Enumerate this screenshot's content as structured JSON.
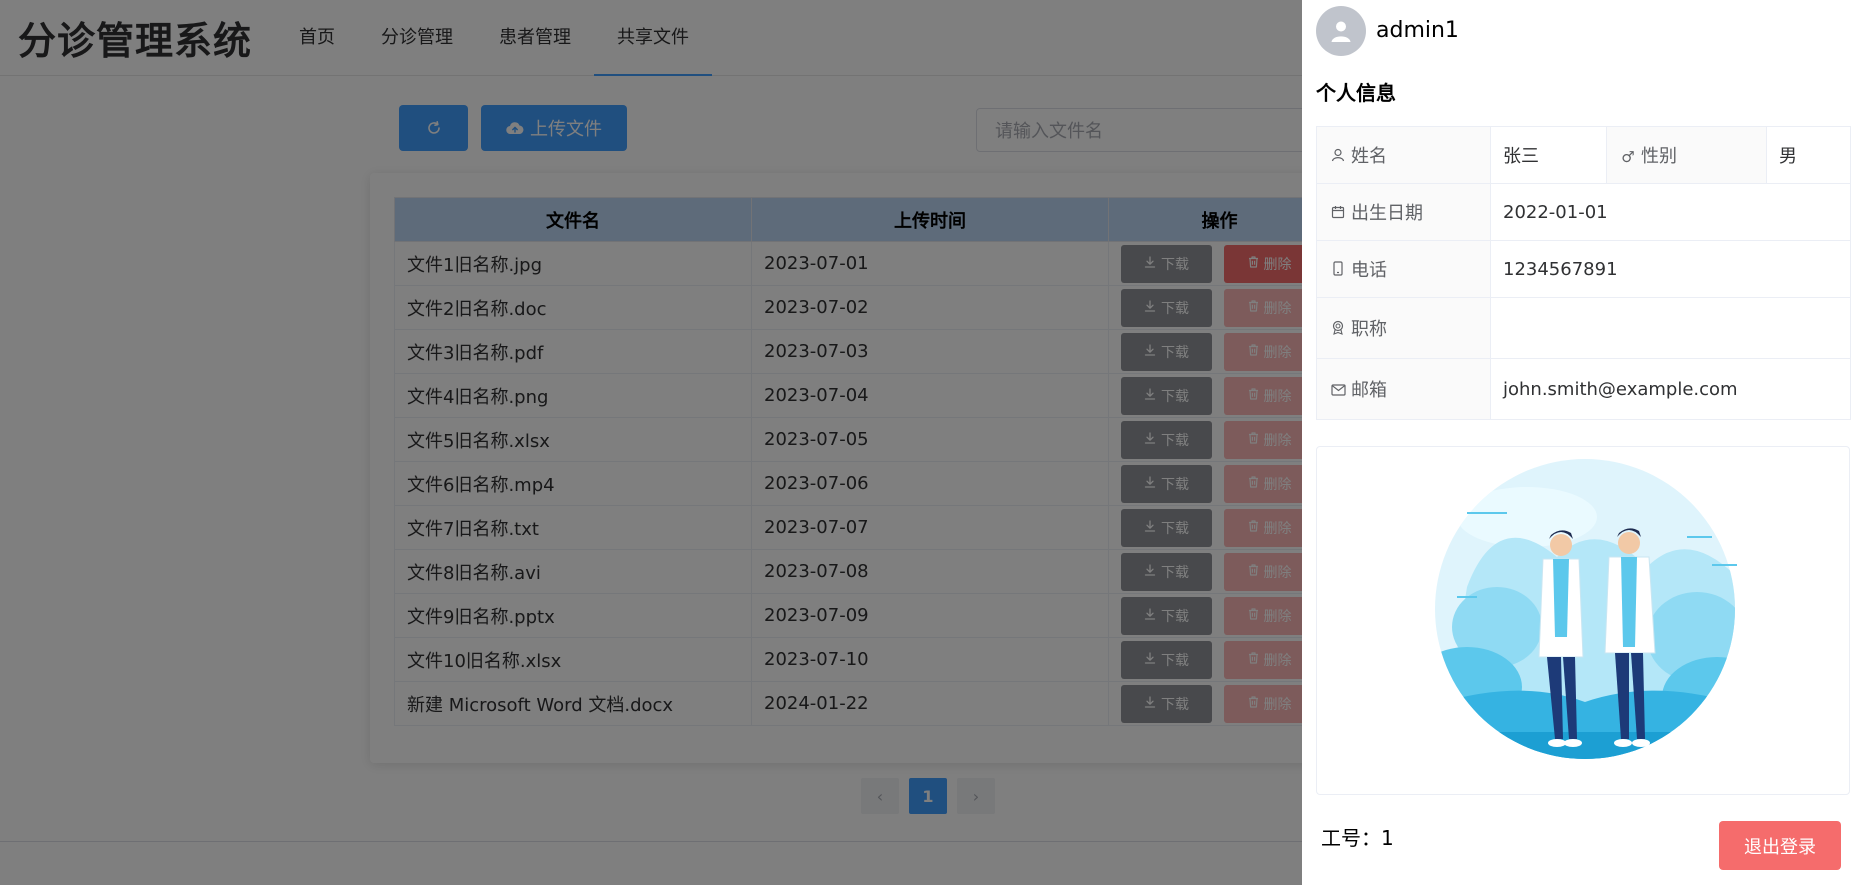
{
  "header": {
    "logo": "分诊管理系统",
    "nav": [
      {
        "label": "首页"
      },
      {
        "label": "分诊管理"
      },
      {
        "label": "患者管理"
      },
      {
        "label": "共享文件"
      }
    ],
    "active_nav": "共享文件"
  },
  "toolbar": {
    "refresh_icon": "refresh-icon",
    "upload_label": "上传文件",
    "search_placeholder": "请输入文件名"
  },
  "table": {
    "columns": [
      "文件名",
      "上传时间",
      "操作"
    ],
    "download_label": "下载",
    "delete_label": "删除",
    "rows": [
      {
        "name": "文件1旧名称.jpg",
        "time": "2023-07-01",
        "delete_enabled": true
      },
      {
        "name": "文件2旧名称.doc",
        "time": "2023-07-02",
        "delete_enabled": false
      },
      {
        "name": "文件3旧名称.pdf",
        "time": "2023-07-03",
        "delete_enabled": false
      },
      {
        "name": "文件4旧名称.png",
        "time": "2023-07-04",
        "delete_enabled": false
      },
      {
        "name": "文件5旧名称.xlsx",
        "time": "2023-07-05",
        "delete_enabled": false
      },
      {
        "name": "文件6旧名称.mp4",
        "time": "2023-07-06",
        "delete_enabled": false
      },
      {
        "name": "文件7旧名称.txt",
        "time": "2023-07-07",
        "delete_enabled": false
      },
      {
        "name": "文件8旧名称.avi",
        "time": "2023-07-08",
        "delete_enabled": false
      },
      {
        "name": "文件9旧名称.pptx",
        "time": "2023-07-09",
        "delete_enabled": false
      },
      {
        "name": "文件10旧名称.xlsx",
        "time": "2023-07-10",
        "delete_enabled": false
      },
      {
        "name": "新建 Microsoft Word 文档.docx",
        "time": "2024-01-22",
        "delete_enabled": false
      }
    ]
  },
  "pagination": {
    "prev": "‹",
    "current": "1",
    "next": "›"
  },
  "drawer": {
    "username": "admin1",
    "section_title": "个人信息",
    "info": {
      "name_label": "姓名",
      "name_value": "张三",
      "gender_label": "性别",
      "gender_value": "男",
      "birth_label": "出生日期",
      "birth_value": "2022-01-01",
      "phone_label": "电话",
      "phone_value": "1234567891",
      "title_label": "职称",
      "title_value": "",
      "email_label": "邮箱",
      "email_value": "john.smith@example.com"
    },
    "employee_id": "工号：1",
    "logout_label": "退出登录"
  },
  "colors": {
    "primary": "#409eff",
    "danger": "#f56c6c",
    "danger_disabled": "#fab6b6",
    "info": "#909399",
    "table_header_bg": "#bcd6f5"
  }
}
